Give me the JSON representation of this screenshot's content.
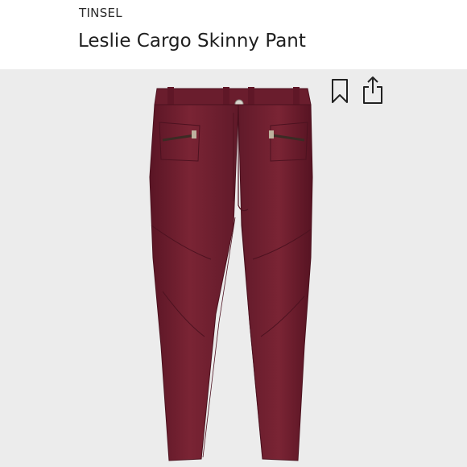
{
  "product": {
    "brand": "TINSEL",
    "name": "Leslie Cargo Skinny Pant",
    "color": "#6e1e2f"
  },
  "icons": {
    "bookmark": "bookmark-icon",
    "share": "share-icon"
  }
}
